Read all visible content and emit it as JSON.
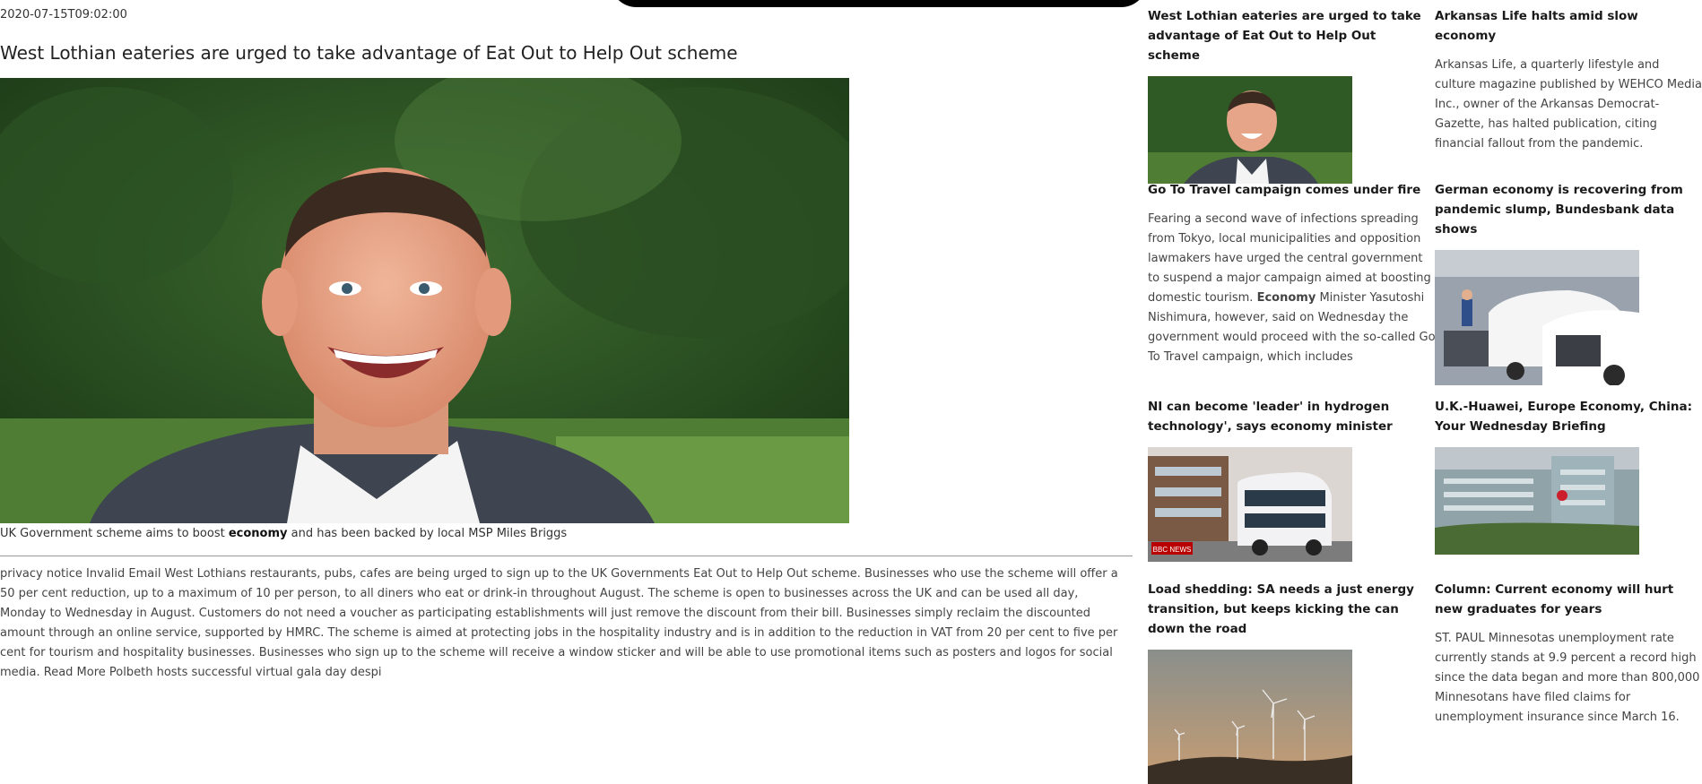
{
  "article": {
    "date": "2020-07-15T09:02:00",
    "headline": "West Lothian eateries are urged to take advantage of Eat Out to Help Out scheme",
    "caption_pre": "UK Government scheme aims to boost ",
    "caption_kw": "economy",
    "caption_post": " and has been backed by local MSP Miles Briggs",
    "body": "privacy notice Invalid Email West Lothians restaurants, pubs, cafes are being urged to sign up to the UK Governments Eat Out to Help Out scheme. Businesses who use the scheme will offer a 50 per cent reduction, up to a maximum of 10 per person, to all diners who eat or drink-in throughout August. The scheme is open to businesses across the UK and can be used all day, Monday to Wednesday in August. Customers do not need a voucher as participating establishments will just remove the discount from their bill. Businesses simply reclaim the discounted amount through an online service, supported by HMRC. The scheme is aimed at protecting jobs in the hospitality industry and is in addition to the reduction in VAT from 20 per cent to five per cent for tourism and hospitality businesses. Businesses who sign up to the scheme will receive a window sticker and will be able to use promotional items such as posters and logos for social media. Read More Polbeth hosts successful virtual gala day despi"
  },
  "sidebar": {
    "col1": [
      {
        "title": "West Lothian eateries are urged to take advantage of Eat Out to Help Out scheme"
      },
      {
        "title": "Go To Travel campaign comes under fire",
        "text_pre": "Fearing a second wave of infections spreading from Tokyo, local municipalities and opposition lawmakers have urged the central government to suspend a major campaign aimed at boosting domestic tourism. ",
        "text_kw": "Economy",
        "text_post": " Minister Yasutoshi Nishimura, however, said on Wednesday the government would proceed with the so-called Go To Travel campaign, which includes"
      },
      {
        "title_pre": "NI can become 'leader' in hydrogen technology', says ",
        "title_kw": "economy",
        "title_post": " minister",
        "badge": "BBC NEWS"
      },
      {
        "title": "Load shedding: SA needs a just energy transition, but keeps kicking the can down the road"
      }
    ],
    "col2": [
      {
        "title_pre": "Arkansas Life halts amid slow ",
        "title_kw": "economy",
        "text": "Arkansas Life, a quarterly lifestyle and culture magazine published by WEHCO Media Inc., owner of the Arkansas Democrat-Gazette, has halted publication, citing financial fallout from the pandemic."
      },
      {
        "title_pre": "German ",
        "title_kw": "economy",
        "title_post": " is recovering from pandemic slump, Bundesbank data shows"
      },
      {
        "title_pre": "U.K.-Huawei, Europe ",
        "title_kw": "Economy",
        "title_post": ", China: Your Wednesday Briefing"
      },
      {
        "title_pre": "Column: Current ",
        "title_kw": "economy",
        "title_post": " will hurt new graduates for years",
        "text": "ST. PAUL Minnesotas unemployment rate currently stands at 9.9 percent a record high since the data began and more than 800,000 Minnesotans have filed claims for unemployment insurance since March 16."
      }
    ]
  }
}
